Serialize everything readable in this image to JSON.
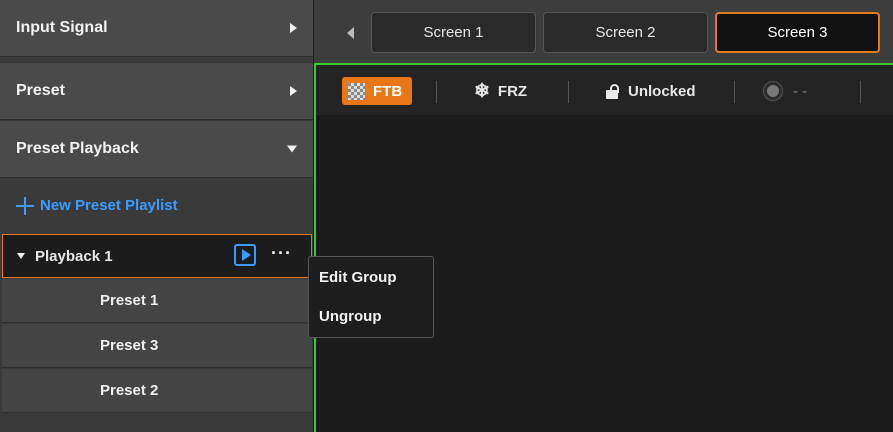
{
  "sidebar": {
    "sections": [
      {
        "label": "Input Signal",
        "arrow": "chevron-right"
      },
      {
        "label": "Preset",
        "arrow": "chevron-right"
      },
      {
        "label": "Preset Playback",
        "arrow": "chevron-down"
      }
    ],
    "new_playlist_label": "New Preset Playlist",
    "playback": {
      "label": "Playback 1",
      "more": "···"
    },
    "presets": [
      "Preset 1",
      "Preset 3",
      "Preset 2"
    ]
  },
  "tabs": {
    "items": [
      "Screen 1",
      "Screen 2",
      "Screen 3"
    ],
    "active": "Screen 3"
  },
  "toolbar": {
    "ftb": "FTB",
    "frz": "FRZ",
    "lock": "Unlocked",
    "brightness": "- -"
  },
  "context_menu": {
    "items": [
      "Edit Group",
      "Ungroup"
    ]
  },
  "colors": {
    "accent": "#e07a1a",
    "link": "#3c9bff",
    "screen_border": "#33cc33"
  }
}
